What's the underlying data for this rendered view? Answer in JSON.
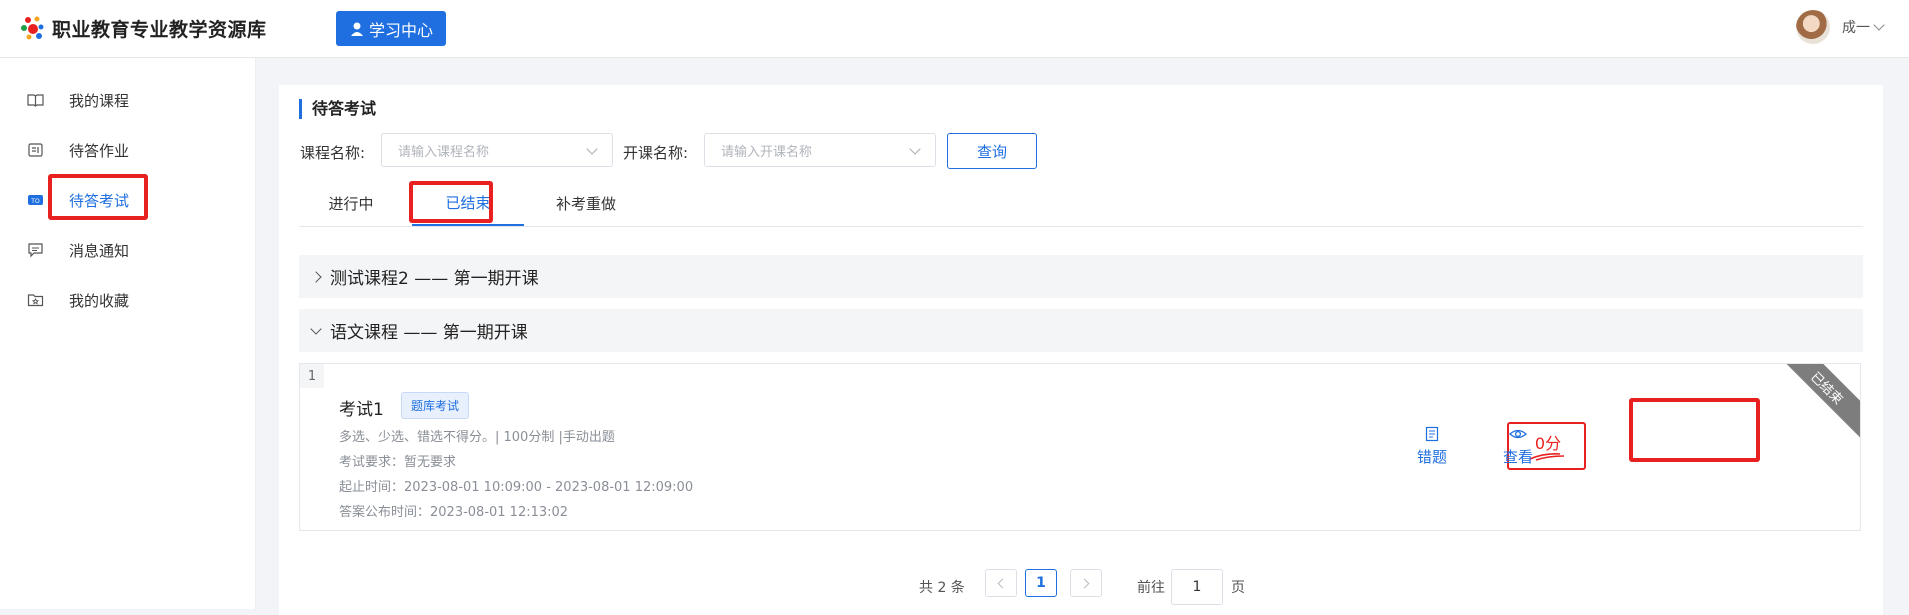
{
  "header": {
    "logo_text": "职业教育专业教学资源库",
    "learn_center": "学习中心",
    "user_name": "成一"
  },
  "sidebar": {
    "items": [
      {
        "label": "我的课程",
        "icon": "book-open-icon"
      },
      {
        "label": "待答作业",
        "icon": "homework-icon"
      },
      {
        "label": "待答考试",
        "icon": "exam-icon",
        "active": true
      },
      {
        "label": "消息通知",
        "icon": "message-icon"
      },
      {
        "label": "我的收藏",
        "icon": "favorite-folder-icon"
      }
    ]
  },
  "main": {
    "section_title": "待答考试",
    "filters": {
      "course_label": "课程名称:",
      "course_placeholder": "请输入课程名称",
      "class_label": "开课名称:",
      "class_placeholder": "请输入开课名称",
      "query_button": "查询"
    },
    "tabs": [
      {
        "label": "进行中"
      },
      {
        "label": "已结束",
        "active": true
      },
      {
        "label": "补考重做"
      }
    ],
    "groups": [
      {
        "title": "测试课程2 —— 第一期开课",
        "expanded": false
      },
      {
        "title": "语文课程 —— 第一期开课",
        "expanded": true
      }
    ],
    "exam": {
      "index": "1",
      "name": "考试1",
      "tag": "题库考试",
      "rules": "多选、少选、错选不得分。| 100分制 |手动出题",
      "requirement": "考试要求：暂无要求",
      "time_range": "起止时间：2023-08-01 10:09:00 - 2023-08-01 12:09:00",
      "answer_publish": "答案公布时间：2023-08-01 12:13:02",
      "score": "0分",
      "wrong_label": "错题",
      "view_label": "查看",
      "status_ribbon": "已结束"
    },
    "pagination": {
      "total": "共 2 条",
      "current_page": "1",
      "goto_prefix": "前往",
      "goto_value": "1",
      "goto_suffix": "页"
    }
  },
  "colors": {
    "accent": "#1f6fe0",
    "highlight": "#e8201f"
  }
}
